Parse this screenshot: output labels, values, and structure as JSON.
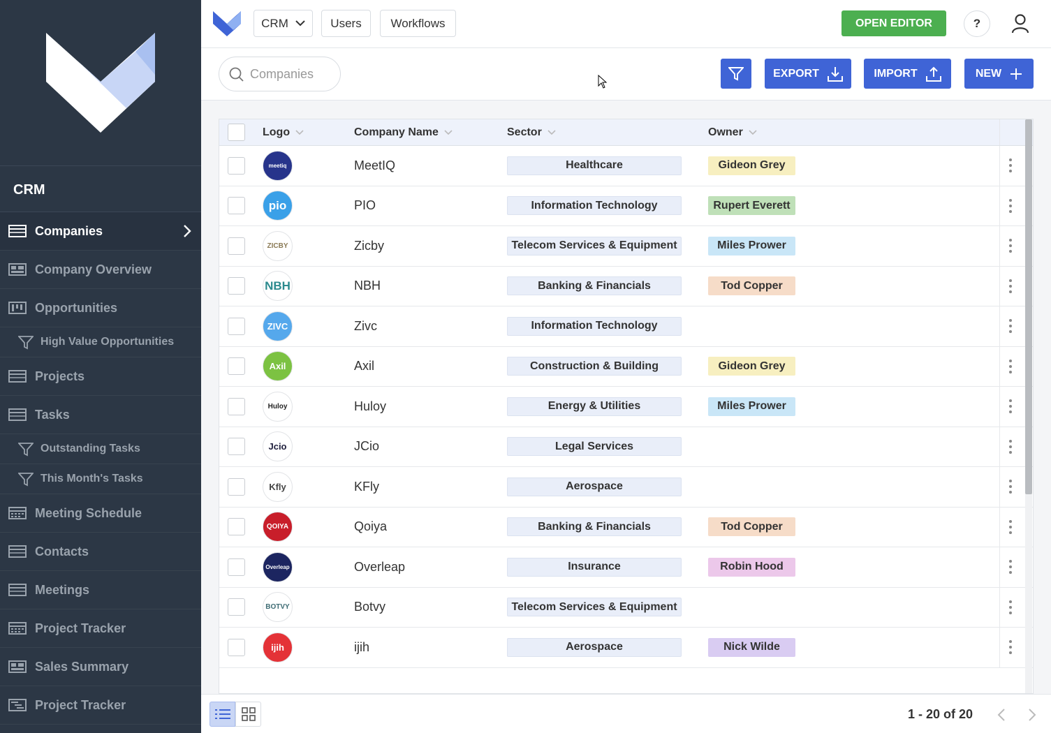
{
  "sidebar": {
    "app_title": "CRM",
    "items": [
      {
        "label": "Companies",
        "icon": "table-icon",
        "active": true
      },
      {
        "label": "Company Overview",
        "icon": "overview-icon"
      },
      {
        "label": "Opportunities",
        "icon": "kanban-icon"
      },
      {
        "label": "High Value Opportunities",
        "icon": "filter-icon",
        "sub": true
      },
      {
        "label": "Projects",
        "icon": "table-icon"
      },
      {
        "label": "Tasks",
        "icon": "table-icon"
      },
      {
        "label": "Outstanding Tasks",
        "icon": "filter-icon",
        "sub": true
      },
      {
        "label": "This Month's Tasks",
        "icon": "filter-icon",
        "sub": true
      },
      {
        "label": "Meeting Schedule",
        "icon": "calendar-icon"
      },
      {
        "label": "Contacts",
        "icon": "table-icon"
      },
      {
        "label": "Meetings",
        "icon": "table-icon"
      },
      {
        "label": "Project Tracker",
        "icon": "calendar-icon"
      },
      {
        "label": "Sales Summary",
        "icon": "overview-icon"
      },
      {
        "label": "Project Tracker",
        "icon": "gantt-icon"
      }
    ]
  },
  "topbar": {
    "nav": [
      "CRM",
      "Users",
      "Workflows"
    ],
    "open_editor": "OPEN EDITOR",
    "help": "?"
  },
  "toolbar": {
    "search_placeholder": "Companies",
    "export": "EXPORT",
    "import": "IMPORT",
    "new": "NEW"
  },
  "table": {
    "columns": [
      "Logo",
      "Company Name",
      "Sector",
      "Owner"
    ],
    "rows": [
      {
        "logo": "meetiq",
        "logo_bg": "#27348b",
        "logo_fg": "#ffffff",
        "name": "MeetIQ",
        "sector": "Healthcare",
        "owner": "Gideon Grey",
        "owner_bg": "#f7efc0"
      },
      {
        "logo": "pio",
        "logo_bg": "#3aa0e8",
        "logo_fg": "#ffffff",
        "name": "PIO",
        "sector": "Information Technology",
        "owner": "Rupert Everett",
        "owner_bg": "#bfe0b8"
      },
      {
        "logo": "ZICBY",
        "logo_bg": "#ffffff",
        "logo_fg": "#8a7a55",
        "name": "Zicby",
        "sector": "Telecom Services & Equipment",
        "owner": "Miles Prower",
        "owner_bg": "#c9e6f7"
      },
      {
        "logo": "NBH",
        "logo_bg": "#ffffff",
        "logo_fg": "#2c8a8e",
        "name": "NBH",
        "sector": "Banking & Financials",
        "owner": "Tod Copper",
        "owner_bg": "#f6dcc8"
      },
      {
        "logo": "ZIVC",
        "logo_bg": "#55a8ec",
        "logo_fg": "#ffffff",
        "name": "Zivc",
        "sector": "Information Technology",
        "owner": "",
        "owner_bg": ""
      },
      {
        "logo": "Axil",
        "logo_bg": "#7cc242",
        "logo_fg": "#ffffff",
        "name": "Axil",
        "sector": "Construction & Building",
        "owner": "Gideon Grey",
        "owner_bg": "#f7efc0"
      },
      {
        "logo": "Huloy",
        "logo_bg": "#ffffff",
        "logo_fg": "#222222",
        "name": "Huloy",
        "sector": "Energy & Utilities",
        "owner": "Miles Prower",
        "owner_bg": "#c9e6f7"
      },
      {
        "logo": "Jcio",
        "logo_bg": "#ffffff",
        "logo_fg": "#1e1e3c",
        "name": "JCio",
        "sector": "Legal Services",
        "owner": "",
        "owner_bg": ""
      },
      {
        "logo": "Kfly",
        "logo_bg": "#ffffff",
        "logo_fg": "#444444",
        "name": "KFly",
        "sector": "Aerospace",
        "owner": "",
        "owner_bg": ""
      },
      {
        "logo": "QOIYA",
        "logo_bg": "#c81e2a",
        "logo_fg": "#ffffff",
        "name": "Qoiya",
        "sector": "Banking & Financials",
        "owner": "Tod Copper",
        "owner_bg": "#f6dcc8"
      },
      {
        "logo": "Overleap",
        "logo_bg": "#1c2560",
        "logo_fg": "#ffffff",
        "name": "Overleap",
        "sector": "Insurance",
        "owner": "Robin Hood",
        "owner_bg": "#ecc8ea"
      },
      {
        "logo": "BOTVY",
        "logo_bg": "#ffffff",
        "logo_fg": "#3d6b73",
        "name": "Botvy",
        "sector": "Telecom Services & Equipment",
        "owner": "",
        "owner_bg": ""
      },
      {
        "logo": "ijih",
        "logo_bg": "#e43237",
        "logo_fg": "#ffffff",
        "name": "ijih",
        "sector": "Aerospace",
        "owner": "Nick Wilde",
        "owner_bg": "#d9ccf2"
      }
    ]
  },
  "footer": {
    "pager": "1 - 20 of 20"
  },
  "colors": {
    "sidebar": "#2c3745",
    "accent": "#3f64d6",
    "green": "#4caf50"
  }
}
